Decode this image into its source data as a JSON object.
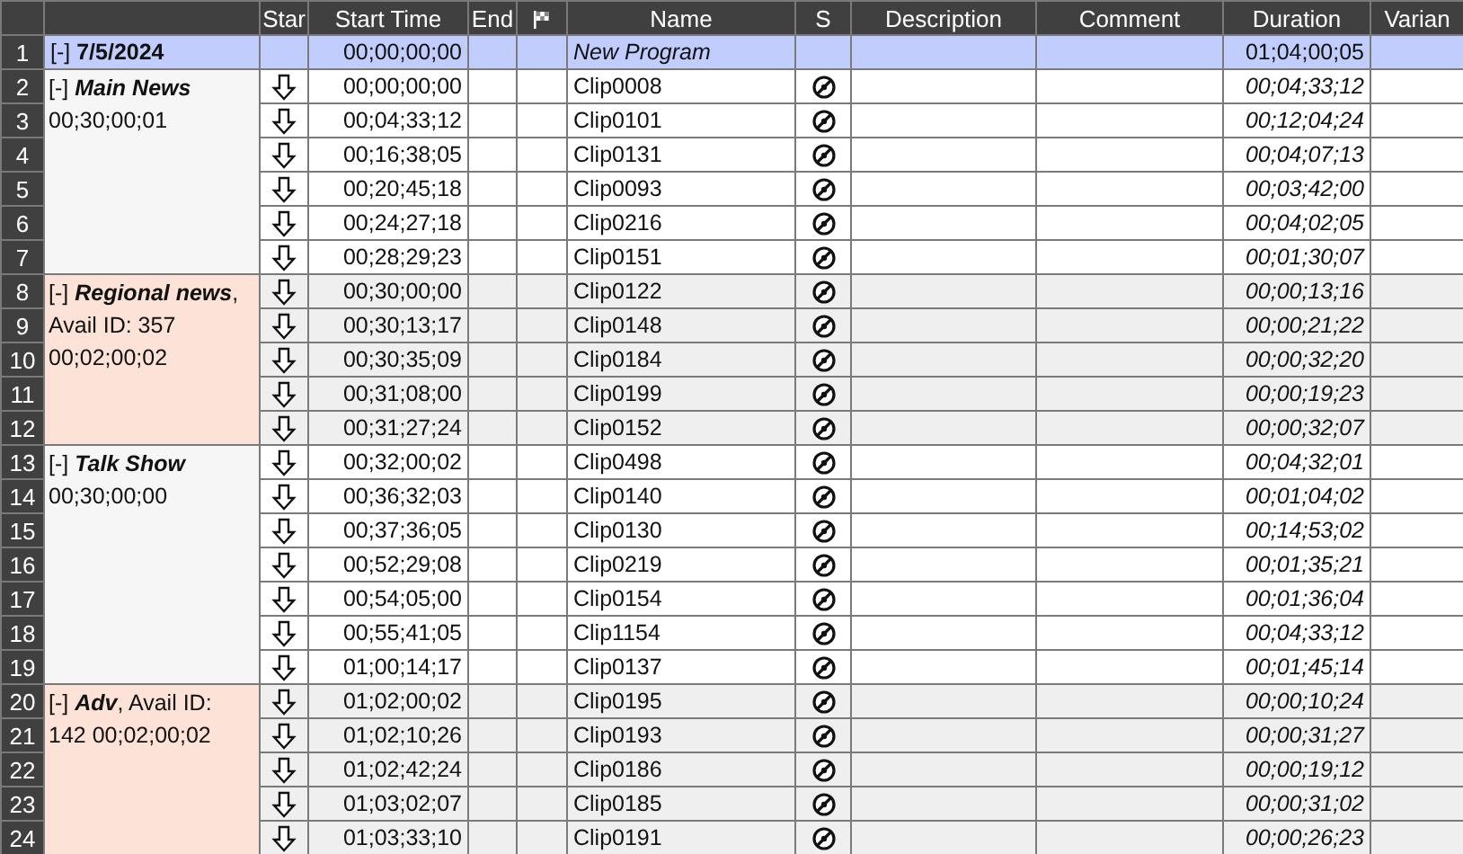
{
  "columns": [
    {
      "kind": "blank"
    },
    {
      "kind": "blank"
    },
    {
      "kind": "text",
      "label": "Star"
    },
    {
      "kind": "text",
      "label": "Start Time"
    },
    {
      "kind": "text",
      "label": "End"
    },
    {
      "kind": "flag"
    },
    {
      "kind": "text",
      "label": "Name"
    },
    {
      "kind": "text",
      "label": "S"
    },
    {
      "kind": "text",
      "label": "Description"
    },
    {
      "kind": "text",
      "label": "Comment"
    },
    {
      "kind": "text",
      "label": "Duration"
    },
    {
      "kind": "text",
      "label": "Varian"
    }
  ],
  "program": {
    "num": "1",
    "toggle": "[-]",
    "title": "7/5/2024",
    "start": "00;00;00;00",
    "name": "New Program",
    "duration": "01;04;00;05"
  },
  "groups": [
    {
      "kind": "segment",
      "toggle": "[-]",
      "title": "Main News",
      "lines": [
        "00;30;00;01"
      ],
      "clips": [
        {
          "num": "2",
          "start": "00;00;00;00",
          "name": "Clip0008",
          "duration": "00;04;33;12"
        },
        {
          "num": "3",
          "start": "00;04;33;12",
          "name": "Clip0101",
          "duration": "00;12;04;24"
        },
        {
          "num": "4",
          "start": "00;16;38;05",
          "name": "Clip0131",
          "duration": "00;04;07;13"
        },
        {
          "num": "5",
          "start": "00;20;45;18",
          "name": "Clip0093",
          "duration": "00;03;42;00"
        },
        {
          "num": "6",
          "start": "00;24;27;18",
          "name": "Clip0216",
          "duration": "00;04;02;05"
        },
        {
          "num": "7",
          "start": "00;28;29;23",
          "name": "Clip0151",
          "duration": "00;01;30;07"
        }
      ]
    },
    {
      "kind": "avail",
      "toggle": "[-]",
      "title": "Regional news",
      "after_title": ",",
      "lines": [
        "Avail ID: 357",
        "00;02;00;02"
      ],
      "clips": [
        {
          "num": "8",
          "start": "00;30;00;00",
          "name": "Clip0122",
          "duration": "00;00;13;16"
        },
        {
          "num": "9",
          "start": "00;30;13;17",
          "name": "Clip0148",
          "duration": "00;00;21;22"
        },
        {
          "num": "10",
          "start": "00;30;35;09",
          "name": "Clip0184",
          "duration": "00;00;32;20"
        },
        {
          "num": "11",
          "start": "00;31;08;00",
          "name": "Clip0199",
          "duration": "00;00;19;23"
        },
        {
          "num": "12",
          "start": "00;31;27;24",
          "name": "Clip0152",
          "duration": "00;00;32;07"
        }
      ]
    },
    {
      "kind": "segment",
      "toggle": "[-]",
      "title": "Talk Show",
      "lines": [
        "00;30;00;00"
      ],
      "clips": [
        {
          "num": "13",
          "start": "00;32;00;02",
          "name": "Clip0498",
          "duration": "00;04;32;01"
        },
        {
          "num": "14",
          "start": "00;36;32;03",
          "name": "Clip0140",
          "duration": "00;01;04;02"
        },
        {
          "num": "15",
          "start": "00;37;36;05",
          "name": "Clip0130",
          "duration": "00;14;53;02"
        },
        {
          "num": "16",
          "start": "00;52;29;08",
          "name": "Clip0219",
          "duration": "00;01;35;21"
        },
        {
          "num": "17",
          "start": "00;54;05;00",
          "name": "Clip0154",
          "duration": "00;01;36;04"
        },
        {
          "num": "18",
          "start": "00;55;41;05",
          "name": "Clip1154",
          "duration": "00;04;33;12"
        },
        {
          "num": "19",
          "start": "01;00;14;17",
          "name": "Clip0137",
          "duration": "00;01;45;14"
        }
      ]
    },
    {
      "kind": "avail",
      "toggle": "[-]",
      "title": "Adv",
      "after_title": ", Avail ID:",
      "lines": [
        "142  00;02;00;02"
      ],
      "clips": [
        {
          "num": "20",
          "start": "01;02;00;02",
          "name": "Clip0195",
          "duration": "00;00;10;24"
        },
        {
          "num": "21",
          "start": "01;02;10;26",
          "name": "Clip0193",
          "duration": "00;00;31;27"
        },
        {
          "num": "22",
          "start": "01;02;42;24",
          "name": "Clip0186",
          "duration": "00;00;19;12"
        },
        {
          "num": "23",
          "start": "01;03;02;07",
          "name": "Clip0185",
          "duration": "00;00;31;02"
        },
        {
          "num": "24",
          "start": "01;03;33;10",
          "name": "Clip0191",
          "duration": "00;00;26;23"
        }
      ]
    }
  ]
}
